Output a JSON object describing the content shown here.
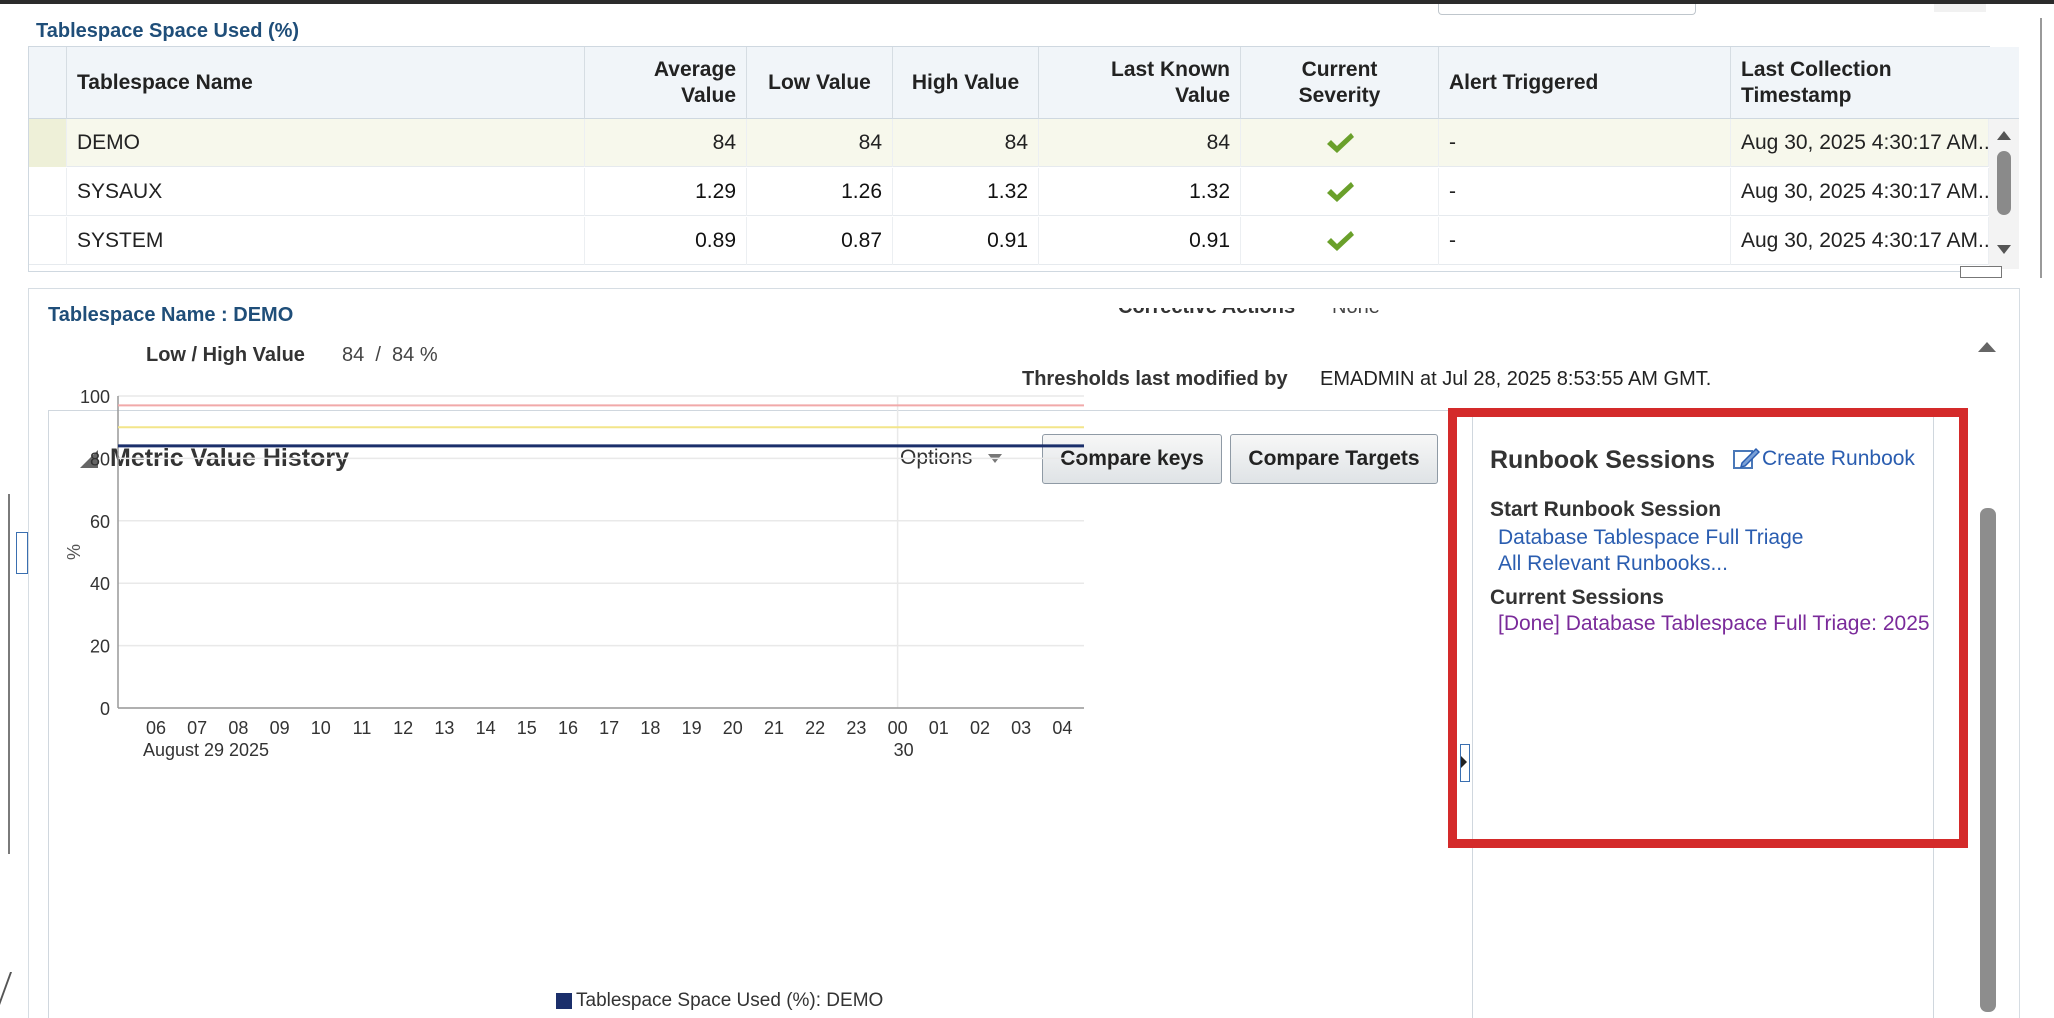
{
  "section_title": "Tablespace Space Used (%)",
  "table": {
    "headers": {
      "name": "Tablespace Name",
      "avg": [
        "Average",
        "Value"
      ],
      "low": "Low Value",
      "high": "High Value",
      "last": [
        "Last Known",
        "Value"
      ],
      "severity": [
        "Current",
        "Severity"
      ],
      "alert": "Alert Triggered",
      "ts": [
        "Last Collection",
        "Timestamp"
      ]
    },
    "rows": [
      {
        "name": "DEMO",
        "avg": "84",
        "low": "84",
        "high": "84",
        "last": "84",
        "alert": "-",
        "ts": "Aug 30, 2025 4:30:17 AM..."
      },
      {
        "name": "SYSAUX",
        "avg": "1.29",
        "low": "1.26",
        "high": "1.32",
        "last": "1.32",
        "alert": "-",
        "ts": "Aug 30, 2025 4:30:17 AM..."
      },
      {
        "name": "SYSTEM",
        "avg": "0.89",
        "low": "0.87",
        "high": "0.91",
        "last": "0.91",
        "alert": "-",
        "ts": "Aug 30, 2025 4:30:17 AM..."
      }
    ],
    "severity_icon": "check-icon",
    "severity_color": "#6aa02b"
  },
  "detail": {
    "tablespace_label": "Tablespace Name : DEMO",
    "low_high_label": "Low / High Value",
    "low_high_value": "84  /  84 %",
    "corrective_label": "Corrective Actions",
    "corrective_value": "None",
    "thresholds_label": "Thresholds last modified by",
    "thresholds_value": "EMADMIN at Jul 28, 2025 8:53:55 AM GMT."
  },
  "history": {
    "title": "Metric Value History",
    "options_label": "Options",
    "compare_keys": "Compare keys",
    "compare_targets": "Compare Targets"
  },
  "runbook": {
    "title": "Runbook Sessions",
    "create_link": "Create Runbook",
    "start_heading": "Start Runbook Session",
    "start_links": [
      "Database Tablespace Full Triage",
      "All Relevant Runbooks..."
    ],
    "current_heading": "Current Sessions",
    "current_links": [
      "[Done] Database Tablespace Full Triage: 2025"
    ],
    "highlight_color": "#d42a2a"
  },
  "chart_data": {
    "type": "line",
    "ylabel": "%",
    "ylim": [
      0,
      100
    ],
    "yticks": [
      0,
      20,
      40,
      60,
      80,
      100
    ],
    "xticks": [
      "06",
      "07",
      "08",
      "09",
      "10",
      "11",
      "12",
      "13",
      "14",
      "15",
      "16",
      "17",
      "18",
      "19",
      "20",
      "21",
      "22",
      "23",
      "00",
      "01",
      "02",
      "03",
      "04"
    ],
    "date_labels": [
      {
        "at": "06",
        "text": "August 29 2025"
      },
      {
        "at": "00",
        "text": "30"
      }
    ],
    "series": [
      {
        "name": "Tablespace Space Used (%): DEMO",
        "values": [
          84,
          84,
          84,
          84,
          84,
          84,
          84,
          84,
          84,
          84,
          84,
          84,
          84,
          84,
          84,
          84,
          84,
          84,
          84,
          84,
          84,
          84,
          84,
          84
        ],
        "color": "#1b2f6b"
      }
    ],
    "thresholds": [
      {
        "value": 97,
        "color": "#f1a9a9"
      },
      {
        "value": 90,
        "color": "#f3e58a"
      }
    ],
    "grid": true,
    "legend": "bottom-left"
  }
}
